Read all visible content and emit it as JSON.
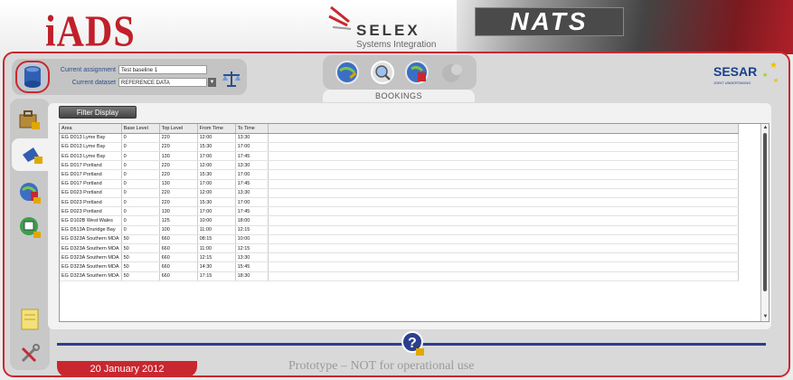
{
  "header": {
    "app_logo": "iADS",
    "partner_name": "SELEX",
    "partner_sub": "Systems Integration",
    "partner2": "NATS"
  },
  "assignment": {
    "current_assignment_label": "Current assignment",
    "current_assignment_value": "Test baseline 1",
    "current_dataset_label": "Current dataset",
    "current_dataset_value": "REFERENCE DATA"
  },
  "tabs": {
    "active": "BOOKINGS"
  },
  "sesar": {
    "name": "SESAR",
    "sub": "JOINT UNDERTAKING"
  },
  "toolbar": {
    "filter_label": "Filter Display"
  },
  "table": {
    "columns": [
      "Area",
      "Base Level",
      "Top Level",
      "From Time",
      "To Time"
    ],
    "rows": [
      [
        "EG D013 Lyme Bay",
        "0",
        "220",
        "12:00",
        "13:30"
      ],
      [
        "EG D013 Lyme Bay",
        "0",
        "220",
        "15:30",
        "17:00"
      ],
      [
        "EG D013 Lyme Bay",
        "0",
        "130",
        "17:00",
        "17:45"
      ],
      [
        "EG D017 Portland",
        "0",
        "220",
        "12:00",
        "13:30"
      ],
      [
        "EG D017 Portland",
        "0",
        "220",
        "15:30",
        "17:00"
      ],
      [
        "EG D017 Portland",
        "0",
        "130",
        "17:00",
        "17:45"
      ],
      [
        "EG D023 Portland",
        "0",
        "220",
        "12:00",
        "13:30"
      ],
      [
        "EG D023 Portland",
        "0",
        "220",
        "15:30",
        "17:00"
      ],
      [
        "EG D023 Portland",
        "0",
        "130",
        "17:00",
        "17:45"
      ],
      [
        "EG D102B West Wales",
        "0",
        "125",
        "10:00",
        "18:00"
      ],
      [
        "EG D513A Druridge Bay",
        "0",
        "100",
        "11:00",
        "12:15"
      ],
      [
        "EG D323A Southern MDA",
        "50",
        "660",
        "08:15",
        "10:00"
      ],
      [
        "EG D323A Southern MDA",
        "50",
        "660",
        "11:00",
        "12:15"
      ],
      [
        "EG D323A Southern MDA",
        "50",
        "660",
        "12:15",
        "13:30"
      ],
      [
        "EG D323A Southern MDA",
        "50",
        "660",
        "14:30",
        "15:45"
      ],
      [
        "EG D323A Southern MDA",
        "50",
        "660",
        "17:15",
        "18:30"
      ]
    ]
  },
  "footer": {
    "date": "20 January 2012",
    "notice": "Prototype – NOT for operational use"
  },
  "colors": {
    "accent": "#c9272f",
    "navy": "#2b3f8f"
  }
}
